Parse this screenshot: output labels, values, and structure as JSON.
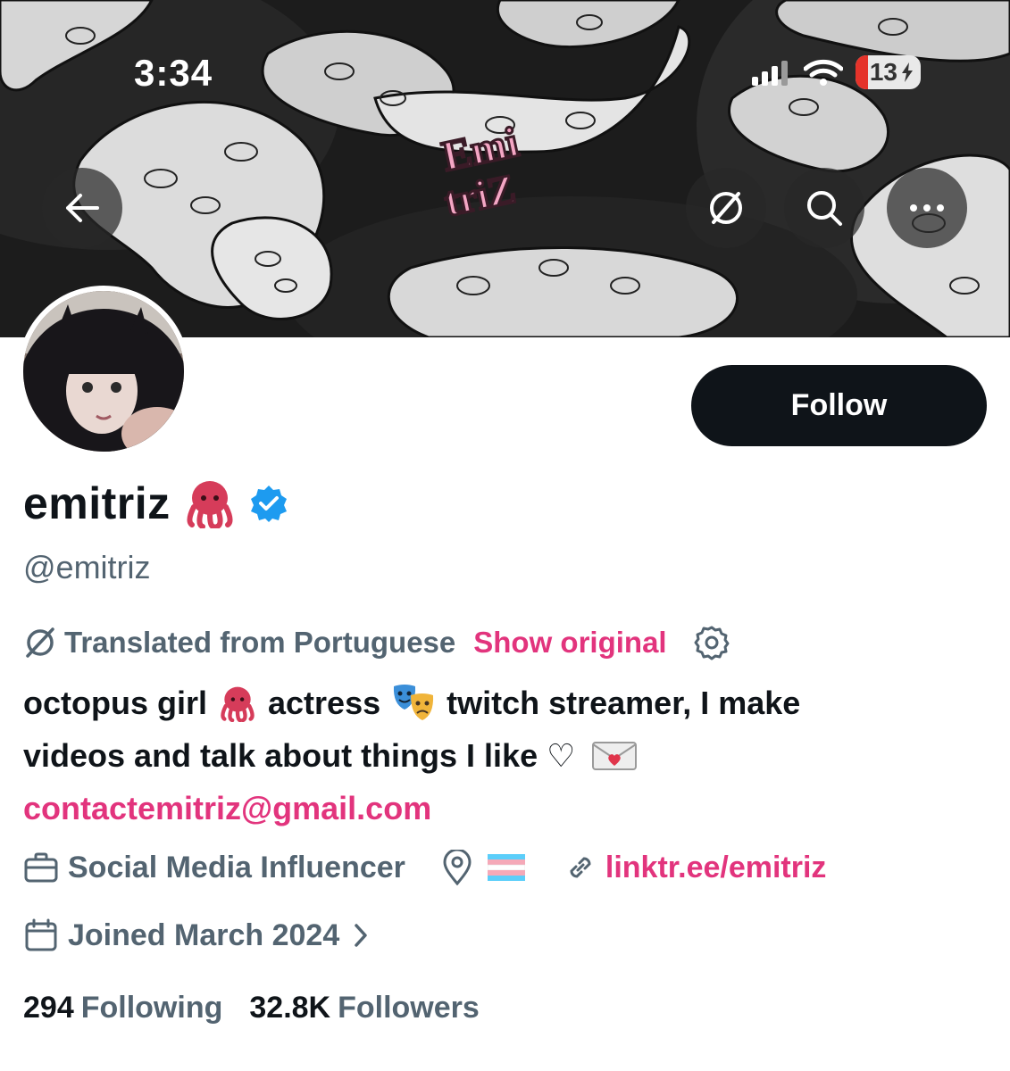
{
  "status_bar": {
    "time": "3:34",
    "battery": "13"
  },
  "banner_logo": {
    "line1": "Emi",
    "line2": "triZ"
  },
  "profile": {
    "follow_label": "Follow",
    "display_name": "emitriz",
    "handle": "@emitriz",
    "translated_label": "Translated from Portuguese",
    "show_original_label": "Show original",
    "bio_line1_a": "octopus girl",
    "bio_line1_b": "actress",
    "bio_line1_c": "twitch streamer, I make",
    "bio_line2": "videos and talk about things I like ♡",
    "bio_email": "contactemitriz@gmail.com",
    "category": "Social Media Influencer",
    "website": "linktr.ee/emitriz",
    "joined": "Joined March 2024",
    "following_count": "294",
    "following_label": "Following",
    "followers_count": "32.8K",
    "followers_label": "Followers"
  },
  "colors": {
    "accent_pink": "#e2347d",
    "verified_blue": "#1d9bf0",
    "muted": "#536471",
    "button_dark": "#0f1419"
  },
  "icons": [
    "back-arrow-icon",
    "translate-icon",
    "search-icon",
    "more-icon",
    "octopus-emoji",
    "verified-badge-icon",
    "settings-gear-icon",
    "theater-masks-emoji",
    "love-letter-emoji",
    "briefcase-icon",
    "location-pin-icon",
    "trans-flag-emoji",
    "link-icon",
    "calendar-icon",
    "chevron-right-icon",
    "signal-icon",
    "wifi-icon",
    "battery-icon"
  ]
}
